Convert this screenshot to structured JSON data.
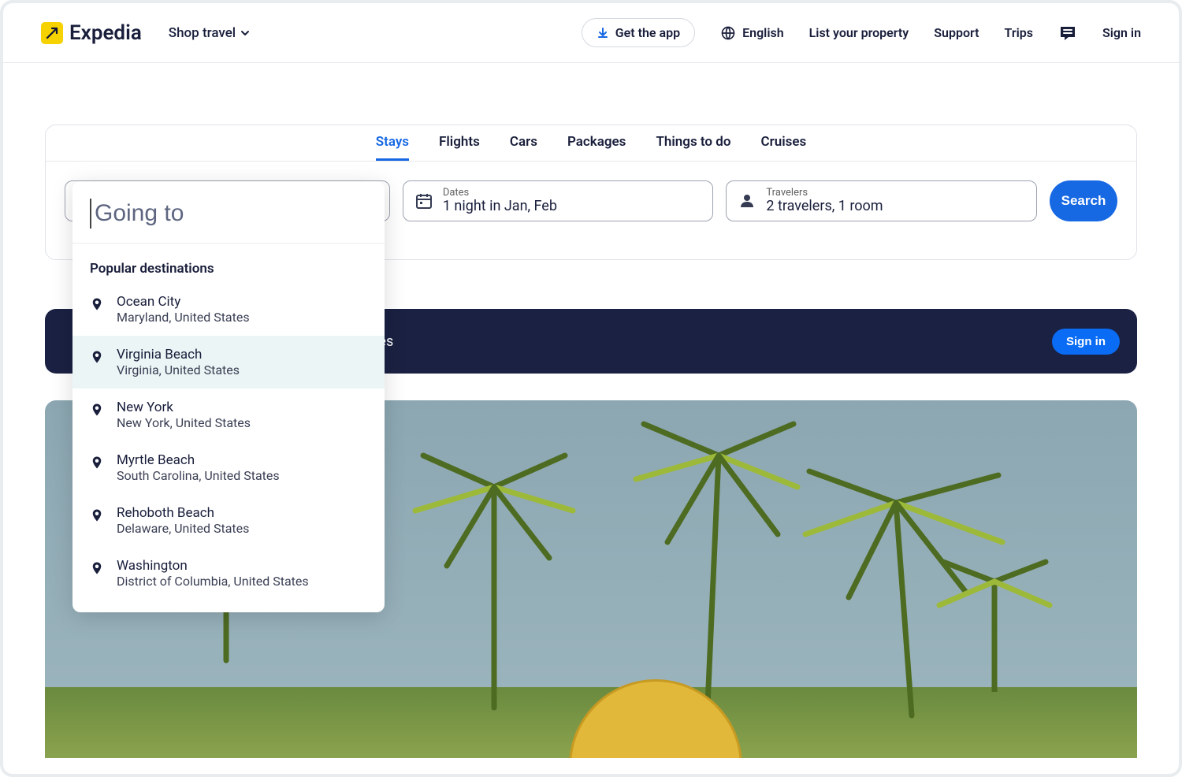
{
  "brand": "Expedia",
  "header": {
    "shop_travel": "Shop travel",
    "get_app": "Get the app",
    "language": "English",
    "list_property": "List your property",
    "support": "Support",
    "trips": "Trips",
    "sign_in": "Sign in"
  },
  "tabs": [
    "Stays",
    "Flights",
    "Cars",
    "Packages",
    "Things to do",
    "Cruises"
  ],
  "active_tab_index": 0,
  "search": {
    "dates_label": "Dates",
    "dates_value": "1 night in Jan, Feb",
    "travelers_label": "Travelers",
    "travelers_value": "2 travelers, 1 room",
    "button": "Search"
  },
  "dropdown": {
    "placeholder": "Going to",
    "section_title": "Popular destinations",
    "highlight_index": 1,
    "items": [
      {
        "main": "Ocean City",
        "sub": "Maryland, United States"
      },
      {
        "main": "Virginia Beach",
        "sub": "Virginia, United States"
      },
      {
        "main": "New York",
        "sub": "New York, United States"
      },
      {
        "main": "Myrtle Beach",
        "sub": "South Carolina, United States"
      },
      {
        "main": "Rehoboth Beach",
        "sub": "Delaware, United States"
      },
      {
        "main": "Washington",
        "sub": "District of Columbia, United States"
      }
    ]
  },
  "banner": {
    "text_visible": "ces",
    "sign_in": "Sign in"
  }
}
